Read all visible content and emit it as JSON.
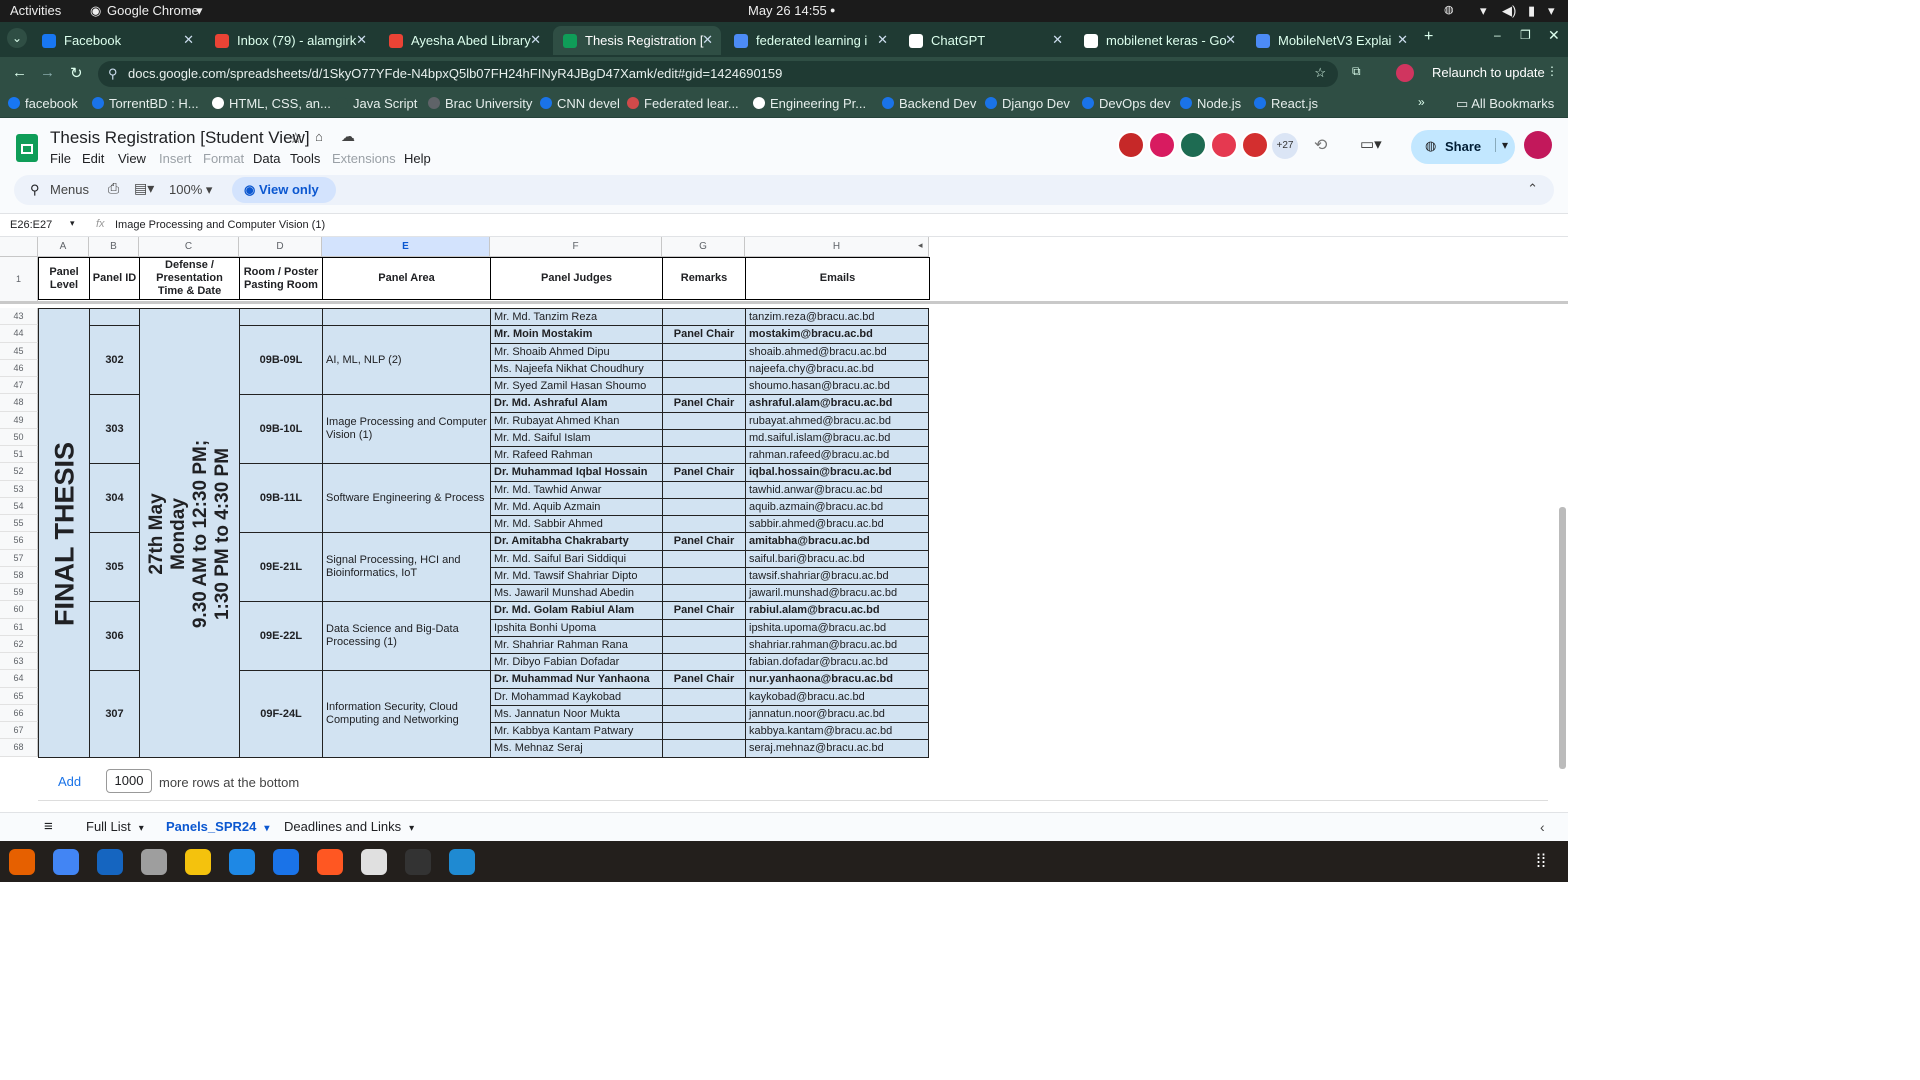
{
  "system": {
    "activities": "Activities",
    "app": "Google Chrome",
    "datetime": "May 26  14:55"
  },
  "tabs": [
    {
      "label": "Facebook",
      "color": "#1877f2"
    },
    {
      "label": "Inbox (79) - alamgirk",
      "color": "#ea4335"
    },
    {
      "label": "Ayesha Abed Library",
      "color": "#ea4335"
    },
    {
      "label": "Thesis Registration [",
      "color": "#0f9d58",
      "active": true
    },
    {
      "label": "federated learning i",
      "color": "#4c8bf5"
    },
    {
      "label": "ChatGPT",
      "color": "#ffffff"
    },
    {
      "label": "mobilenet keras - Go",
      "color": "#ffffff"
    },
    {
      "label": "MobileNetV3 Explai",
      "color": "#4c8bf5"
    }
  ],
  "address": {
    "url": "docs.google.com/spreadsheets/d/1SkyO77YFde-N4bpxQ5lb07FH24hFINyR4JBgD47Xamk/edit#gid=1424690159",
    "relaunch": "Relaunch to update"
  },
  "bookmarks": [
    "facebook",
    "TorrentBD : H...",
    "HTML, CSS, an...",
    "Java Script",
    "Brac University",
    "CNN devel",
    "Federated lear...",
    "Engineering Pr...",
    "Backend Dev",
    "Django Dev",
    "DevOps dev",
    "Node.js",
    "React.js"
  ],
  "all_bookmarks": "All Bookmarks",
  "doc": {
    "title": "Thesis Registration [Student View]",
    "menus": [
      "File",
      "Edit",
      "View",
      "Insert",
      "Format",
      "Data",
      "Tools",
      "Extensions",
      "Help"
    ],
    "collab_more": "+27",
    "share": "Share",
    "menus_search": "Menus",
    "zoom": "100%",
    "view_only": "View only"
  },
  "formula": {
    "ref": "E26:E27",
    "value": "Image Processing and Computer Vision (1)"
  },
  "columns": [
    "A",
    "B",
    "C",
    "D",
    "E",
    "F",
    "G",
    "H"
  ],
  "headers": [
    "Panel Level",
    "Panel ID",
    "Defense / Presentation Time & Date",
    "Room / Poster Pasting Room",
    "Panel Area",
    "Panel Judges",
    "Remarks",
    "Emails"
  ],
  "level": "FINAL THESIS",
  "datetime_cell": [
    "27th May",
    "Monday",
    "9.30 AM to 12:30 PM;",
    "1:30 PM to 4:30 PM"
  ],
  "first_row": {
    "num": "43",
    "judge": "Mr. Md. Tanzim Reza",
    "email": "tanzim.reza@bracu.ac.bd"
  },
  "panels": [
    {
      "id": "302",
      "room": "09B-09L",
      "area": "AI, ML, NLP (2)",
      "rows": [
        {
          "num": "44",
          "judge": "Mr. Moin Mostakim",
          "remark": "Panel Chair",
          "email": "mostakim@bracu.ac.bd"
        },
        {
          "num": "45",
          "judge": "Mr. Shoaib Ahmed Dipu",
          "remark": "",
          "email": "shoaib.ahmed@bracu.ac.bd"
        },
        {
          "num": "46",
          "judge": "Ms. Najeefa Nikhat Choudhury",
          "remark": "",
          "email": "najeefa.chy@bracu.ac.bd"
        },
        {
          "num": "47",
          "judge": "Mr. Syed Zamil Hasan Shoumo",
          "remark": "",
          "email": "shoumo.hasan@bracu.ac.bd"
        }
      ]
    },
    {
      "id": "303",
      "room": "09B-10L",
      "area": "Image Processing and Computer Vision (1)",
      "rows": [
        {
          "num": "48",
          "judge": "Dr. Md. Ashraful Alam",
          "remark": "Panel Chair",
          "email": "ashraful.alam@bracu.ac.bd"
        },
        {
          "num": "49",
          "judge": "Mr. Rubayat Ahmed Khan",
          "remark": "",
          "email": "rubayat.ahmed@bracu.ac.bd"
        },
        {
          "num": "50",
          "judge": "Mr. Md. Saiful Islam",
          "remark": "",
          "email": "md.saiful.islam@bracu.ac.bd"
        },
        {
          "num": "51",
          "judge": "Mr. Rafeed Rahman",
          "remark": "",
          "email": "rahman.rafeed@bracu.ac.bd"
        }
      ]
    },
    {
      "id": "304",
      "room": "09B-11L",
      "area": "Software Engineering & Process",
      "rows": [
        {
          "num": "52",
          "judge": "Dr. Muhammad Iqbal Hossain",
          "remark": "Panel Chair",
          "email": "iqbal.hossain@bracu.ac.bd"
        },
        {
          "num": "53",
          "judge": "Mr. Md. Tawhid Anwar",
          "remark": "",
          "email": "tawhid.anwar@bracu.ac.bd"
        },
        {
          "num": "54",
          "judge": "Mr. Md. Aquib Azmain",
          "remark": "",
          "email": "aquib.azmain@bracu.ac.bd"
        },
        {
          "num": "55",
          "judge": "Mr. Md. Sabbir Ahmed",
          "remark": "",
          "email": "sabbir.ahmed@bracu.ac.bd"
        }
      ]
    },
    {
      "id": "305",
      "room": "09E-21L",
      "area": "Signal Processing, HCI and Bioinformatics, IoT",
      "rows": [
        {
          "num": "56",
          "judge": "Dr. Amitabha Chakrabarty",
          "remark": "Panel Chair",
          "email": "amitabha@bracu.ac.bd"
        },
        {
          "num": "57",
          "judge": "Mr. Md. Saiful Bari Siddiqui",
          "remark": "",
          "email": "saiful.bari@bracu.ac.bd"
        },
        {
          "num": "58",
          "judge": "Mr. Md. Tawsif Shahriar Dipto",
          "remark": "",
          "email": "tawsif.shahriar@bracu.ac.bd"
        },
        {
          "num": "59",
          "judge": "Ms. Jawaril Munshad Abedin",
          "remark": "",
          "email": "jawaril.munshad@bracu.ac.bd"
        }
      ]
    },
    {
      "id": "306",
      "room": "09E-22L",
      "area": "Data Science and Big-Data Processing (1)",
      "rows": [
        {
          "num": "60",
          "judge": "Dr. Md. Golam Rabiul Alam",
          "remark": "Panel Chair",
          "email": "rabiul.alam@bracu.ac.bd"
        },
        {
          "num": "61",
          "judge": "Ipshita Bonhi Upoma",
          "remark": "",
          "email": "ipshita.upoma@bracu.ac.bd"
        },
        {
          "num": "62",
          "judge": "Mr. Shahriar Rahman Rana",
          "remark": "",
          "email": "shahriar.rahman@bracu.ac.bd"
        },
        {
          "num": "63",
          "judge": "Mr. Dibyo Fabian Dofadar",
          "remark": "",
          "email": "fabian.dofadar@bracu.ac.bd"
        }
      ]
    },
    {
      "id": "307",
      "room": "09F-24L",
      "area": "Information Security, Cloud Computing and Networking",
      "rows": [
        {
          "num": "64",
          "judge": "Dr. Muhammad Nur Yanhaona",
          "remark": "Panel Chair",
          "email": "nur.yanhaona@bracu.ac.bd"
        },
        {
          "num": "65",
          "judge": "Dr. Mohammad Kaykobad",
          "remark": "",
          "email": "kaykobad@bracu.ac.bd"
        },
        {
          "num": "66",
          "judge": "Ms. Jannatun Noor Mukta",
          "remark": "",
          "email": "jannatun.noor@bracu.ac.bd"
        },
        {
          "num": "67",
          "judge": "Mr. Kabbya Kantam Patwary",
          "remark": "",
          "email": "kabbya.kantam@bracu.ac.bd"
        },
        {
          "num": "68",
          "judge": "Ms. Mehnaz Seraj",
          "remark": "",
          "email": "seraj.mehnaz@bracu.ac.bd"
        }
      ]
    }
  ],
  "add_rows": {
    "add": "Add",
    "count": "1000",
    "suffix": "more rows at the bottom"
  },
  "sheets": [
    "Full List",
    "Panels_SPR24",
    "Deadlines and Links"
  ],
  "dock": [
    "firefox-icon",
    "chrome-icon",
    "thunderbird-icon",
    "files-icon",
    "rhythmbox-icon",
    "writer-icon",
    "help-icon",
    "appcenter-icon",
    "libreoffice-icon",
    "terminal-icon",
    "vscode-icon"
  ]
}
